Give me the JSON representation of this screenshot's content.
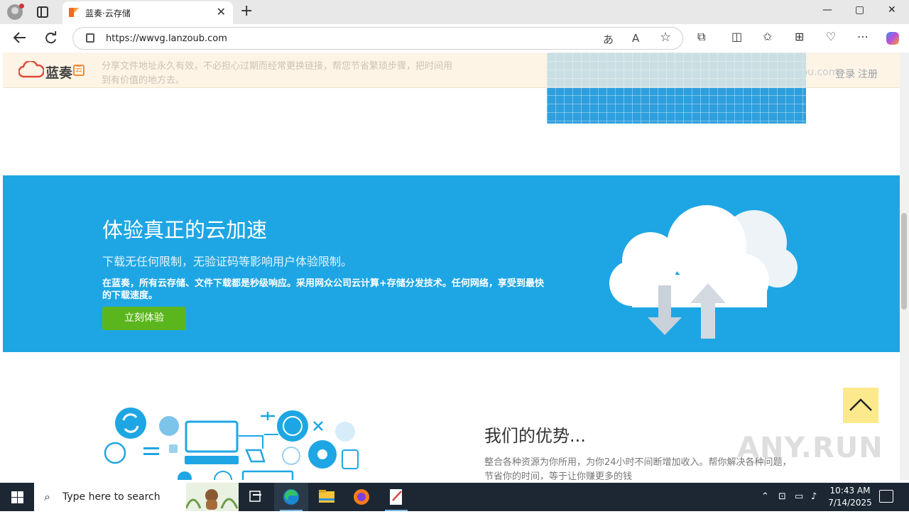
{
  "browser": {
    "tab_title": "蓝奏·云存储",
    "tab_close": "✕",
    "new_tab": "+",
    "url": "https://wwvg.lanzoub.com",
    "window_controls": [
      "—",
      "▢",
      "✕"
    ],
    "icons": [
      "profile-icon",
      "tab-actions-icon",
      "back-arrow-icon",
      "refresh-icon",
      "lock-icon",
      "translate-icon",
      "read-aloud-icon",
      "favorite-star-icon",
      "extensions-icon",
      "split-screen-icon",
      "favorites-icon",
      "collections-icon",
      "browser-essentials-icon",
      "more-icon",
      "copilot-icon"
    ]
  },
  "header": {
    "logo_text": "蓝奏",
    "logo_badge": "云",
    "description": "分享文件地址永久有效，不必担心过期而经常更换链接，帮您节省繁琐步骤，把时间用到有价值的地方去。",
    "site": "Lanzou.com",
    "login": "登录",
    "register": "注册"
  },
  "hero": {
    "title": "体验真正的云加速",
    "subtitle": "下载无任何限制，无验证码等影响用户体验限制。",
    "body": "在蓝奏，所有云存储、文件下载都是秒级响应。采用网众公司云计算+存储分发技术。任何网络，享受到最快的下载速度。",
    "button": "立刻体验"
  },
  "advantages": {
    "title": "我们的优势...",
    "description": "整合各种资源为你所用，为你24小时不间断增加收入。帮你解决各种问题，节省你的时间，等于让你赚更多的钱"
  },
  "watermark": "ANY.RUN",
  "taskbar": {
    "search_placeholder": "Type here to search",
    "time": "10:43 AM",
    "date": "7/14/2025",
    "apps": [
      "task-view-icon",
      "edge-icon",
      "file-explorer-icon",
      "firefox-icon",
      "notepad-icon"
    ]
  },
  "colors": {
    "hero_bg": "#1ea6e4",
    "cta_bg": "#5bb61e",
    "header_bg": "#fdf4e6",
    "back_to_top_bg": "#fce98c",
    "taskbar_bg": "#1c2733"
  }
}
